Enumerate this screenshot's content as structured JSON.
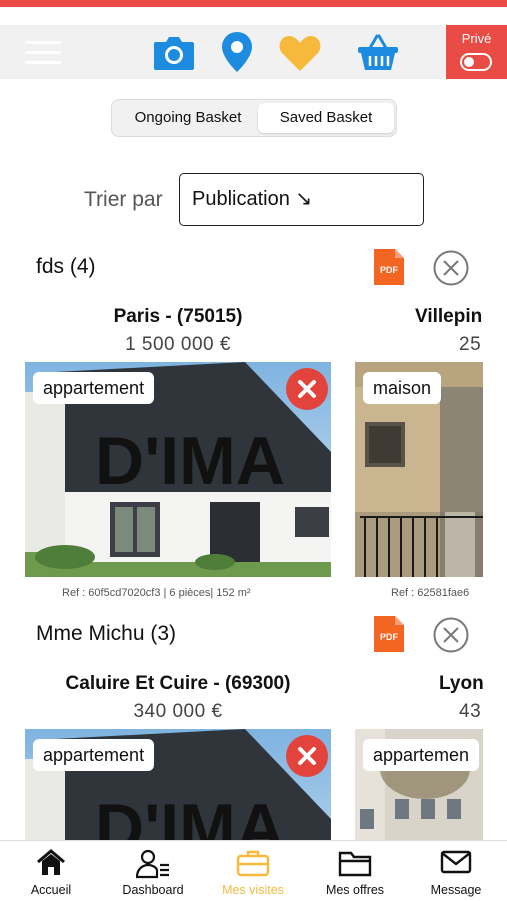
{
  "header": {
    "prive_label": "Privé",
    "icons": [
      "menu-icon",
      "camera-icon",
      "location-pin-icon",
      "heart-icon",
      "basket-icon"
    ],
    "colors": {
      "accent": "#e94b45",
      "blue": "#1d8ce0",
      "yellow": "#f6b93b"
    }
  },
  "segments": {
    "ongoing": "Ongoing Basket",
    "saved": "Saved Basket",
    "active": "Saved Basket"
  },
  "sort": {
    "label": "Trier par",
    "value": "Publication ↘"
  },
  "groups": [
    {
      "title": "fds (4)",
      "cards": [
        {
          "city": "Paris - (75015)",
          "price": "1 500 000  €",
          "type": "appartement",
          "ref": "Ref : 60f5cd7020cf3 | 6 pièces| 152 m²",
          "watermark": "D'IMA"
        },
        {
          "city": "Villepin",
          "price": "25",
          "type": "maison",
          "ref": "Ref : 62581fae6"
        }
      ]
    },
    {
      "title": "Mme Michu (3)",
      "cards": [
        {
          "city": "Caluire Et Cuire - (69300)",
          "price": "340 000  €",
          "type": "appartement",
          "watermark": "D'IMA"
        },
        {
          "city": "Lyon",
          "price": "43",
          "type": "appartemen"
        }
      ]
    }
  ],
  "nav": [
    {
      "label": "Accueil",
      "icon": "home-icon"
    },
    {
      "label": "Dashboard",
      "icon": "user-list-icon"
    },
    {
      "label": "Mes visites",
      "icon": "briefcase-icon",
      "active": true
    },
    {
      "label": "Mes offres",
      "icon": "folder-icon"
    },
    {
      "label": "Message",
      "icon": "mail-icon"
    }
  ]
}
